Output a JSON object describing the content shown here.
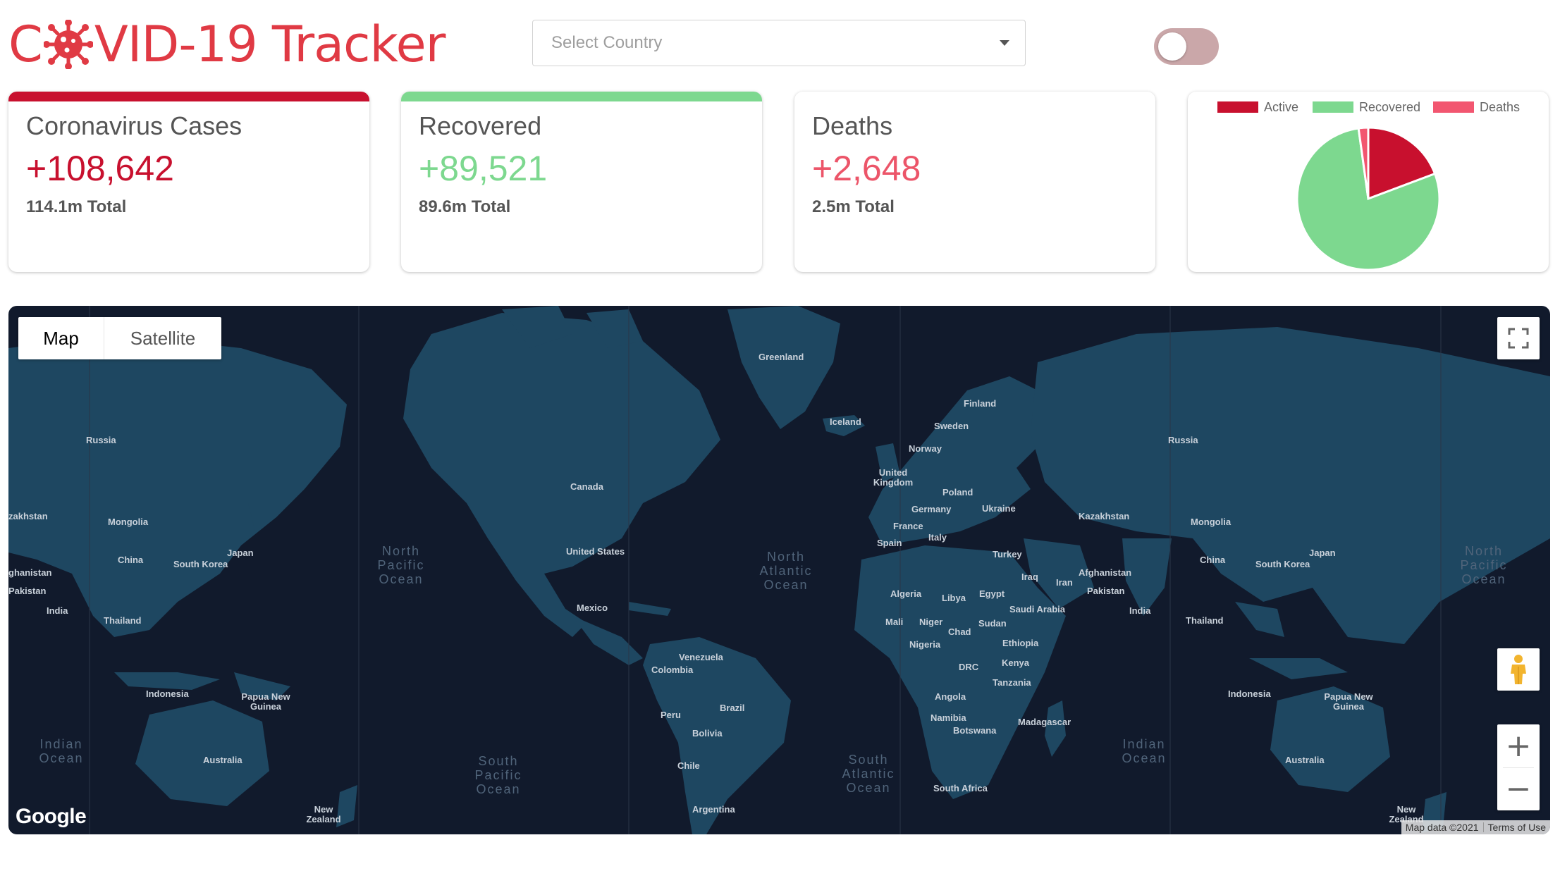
{
  "header": {
    "title_prefix": "C",
    "title_suffix": "VID-19 Tracker",
    "country_placeholder": "Select Country"
  },
  "cards": {
    "cases": {
      "label": "Coronavirus Cases",
      "today": "+108,642",
      "total": "114.1m Total",
      "color": "#c8102e"
    },
    "recovered": {
      "label": "Recovered",
      "today": "+89,521",
      "total": "89.6m Total",
      "color": "#7dd88f"
    },
    "deaths": {
      "label": "Deaths",
      "today": "+2,648",
      "total": "2.5m Total",
      "color": "#ec5569"
    }
  },
  "chart_data": {
    "type": "pie",
    "categories": [
      "Active",
      "Recovered",
      "Deaths"
    ],
    "values": [
      22.0,
      89.6,
      2.5
    ],
    "colors": [
      "#c8102e",
      "#7dd88f",
      "#f25670"
    ],
    "legend": "top"
  },
  "map": {
    "type_control": {
      "map": "Map",
      "satellite": "Satellite"
    },
    "google_logo": "Google",
    "attribution": {
      "data": "Map data ©2021",
      "terms": "Terms of Use"
    },
    "countries": {
      "greenland": "Greenland",
      "iceland": "Iceland",
      "finland": "Finland",
      "sweden": "Sweden",
      "norway": "Norway",
      "united_kingdom": "United Kingdom",
      "poland": "Poland",
      "germany": "Germany",
      "ukraine": "Ukraine",
      "france": "France",
      "italy": "Italy",
      "spain": "Spain",
      "turkey": "Turkey",
      "kazakhstan": "Kazakhstan",
      "iraq": "Iraq",
      "iran": "Iran",
      "afghanistan": "Afghanistan",
      "pakistan": "Pakistan",
      "india": "India",
      "algeria": "Algeria",
      "libya": "Libya",
      "egypt": "Egypt",
      "saudi_arabia": "Saudi Arabia",
      "mali": "Mali",
      "niger": "Niger",
      "chad": "Chad",
      "sudan": "Sudan",
      "nigeria": "Nigeria",
      "ethiopia": "Ethiopia",
      "drc": "DRC",
      "kenya": "Kenya",
      "tanzania": "Tanzania",
      "angola": "Angola",
      "namibia": "Namibia",
      "botswana": "Botswana",
      "madagascar": "Madagascar",
      "south_africa": "South Africa",
      "canada": "Canada",
      "united_states": "United States",
      "mexico": "Mexico",
      "venezuela": "Venezuela",
      "colombia": "Colombia",
      "peru": "Peru",
      "brazil": "Brazil",
      "bolivia": "Bolivia",
      "chile": "Chile",
      "argentina": "Argentina",
      "russia": "Russia",
      "mongolia": "Mongolia",
      "china": "China",
      "south_korea": "South Korea",
      "japan": "Japan",
      "thailand": "Thailand",
      "indonesia": "Indonesia",
      "papua_new_guinea": "Papua New Guinea",
      "australia": "Australia",
      "new_zealand": "New Zealand",
      "kazakhstan_cut": "zakhstan",
      "afghanistan_cut": "ghanistan",
      "pakistan_cut": "Pakistan"
    },
    "oceans": {
      "north_pacific": "North Pacific Ocean",
      "north_atlantic": "North Atlantic Ocean",
      "south_pacific": "South Pacific Ocean",
      "south_atlantic": "South Atlantic Ocean",
      "indian": "Indian Ocean"
    }
  }
}
